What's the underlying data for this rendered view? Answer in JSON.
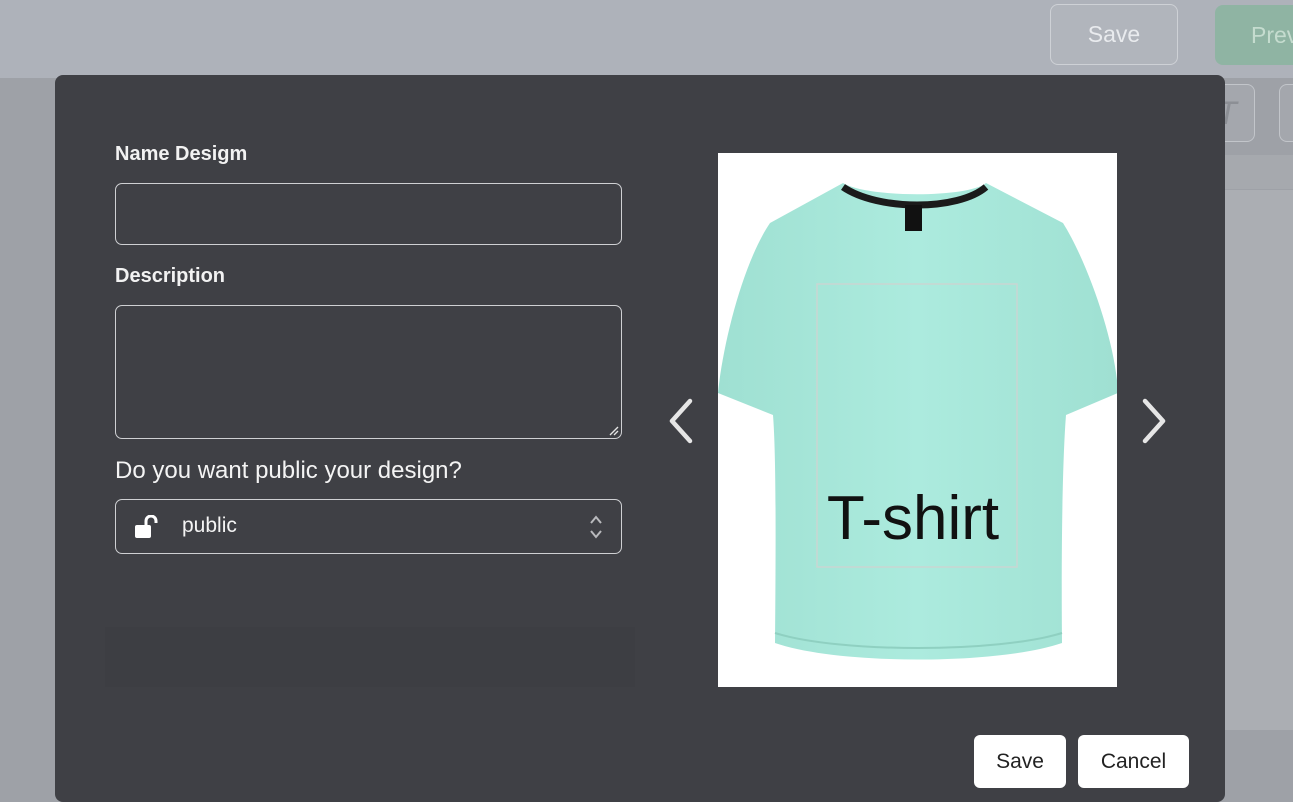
{
  "background": {
    "save_label": "Save",
    "preview_label": "Prev"
  },
  "modal": {
    "name_label": "Name Desigm",
    "name_value": "",
    "description_label": "Description",
    "description_value": "",
    "public_question": "Do you want public your design?",
    "visibility": {
      "selected": "public",
      "icon": "unlock-icon"
    },
    "preview": {
      "product_text": "T-shirt",
      "shirt_color": "#a9e8da",
      "prev_icon": "chevron-left-icon",
      "next_icon": "chevron-right-icon"
    },
    "save_label": "Save",
    "cancel_label": "Cancel"
  }
}
